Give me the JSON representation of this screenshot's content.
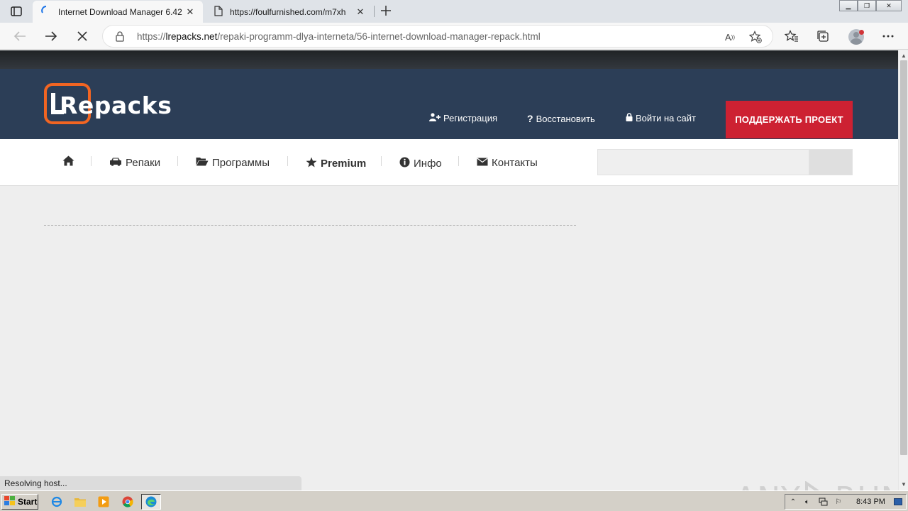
{
  "browser": {
    "tabs": [
      {
        "title": "Internet Download Manager 6.42",
        "active": true
      },
      {
        "title": "https://foulfurnished.com/m7xh",
        "active": false
      }
    ],
    "address": {
      "scheme": "https://",
      "host": "lrepacks.net",
      "path": "/repaki-programm-dlya-interneta/56-internet-download-manager-repack.html"
    },
    "status_text": "Resolving host..."
  },
  "site": {
    "logo_text": "Repacks",
    "header_links": {
      "register": "Регистрация",
      "restore": "Восстановить",
      "login": "Войти на сайт"
    },
    "support_button": "ПОДДЕРЖАТЬ ПРОЕКТ",
    "nav": {
      "repacks": "Репаки",
      "programs": "Программы",
      "premium": "Premium",
      "info": "Инфо",
      "contacts": "Контакты"
    },
    "search_placeholder": ""
  },
  "watermark": {
    "left": "ANY",
    "right": "RUN"
  },
  "taskbar": {
    "start_label": "Start",
    "clock": "8:43 PM"
  },
  "colors": {
    "header_bg": "#2c3e57",
    "support_red": "#cd2132",
    "logo_orange": "#f26522"
  }
}
